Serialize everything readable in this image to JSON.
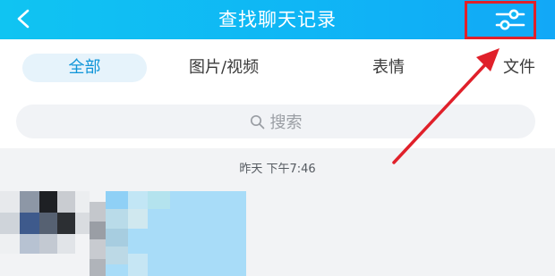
{
  "header": {
    "title": "查找聊天记录",
    "back_icon": "chevron-left-icon",
    "filter_icon": "sliders-icon",
    "background": "#10c4f2",
    "highlight_color": "#e0202a"
  },
  "tabs": [
    {
      "label": "全部",
      "selected": true
    },
    {
      "label": "图片/视频",
      "selected": false
    },
    {
      "label": "表情",
      "selected": false
    },
    {
      "label": "文件",
      "selected": false
    }
  ],
  "search": {
    "placeholder": "搜索",
    "icon": "search-icon"
  },
  "results": {
    "timestamp": "昨天 下午7:46"
  },
  "colors": {
    "accent": "#0f95d8",
    "tab_selected_bg": "#e6f3fb",
    "annotation_arrow": "#e0202a"
  }
}
